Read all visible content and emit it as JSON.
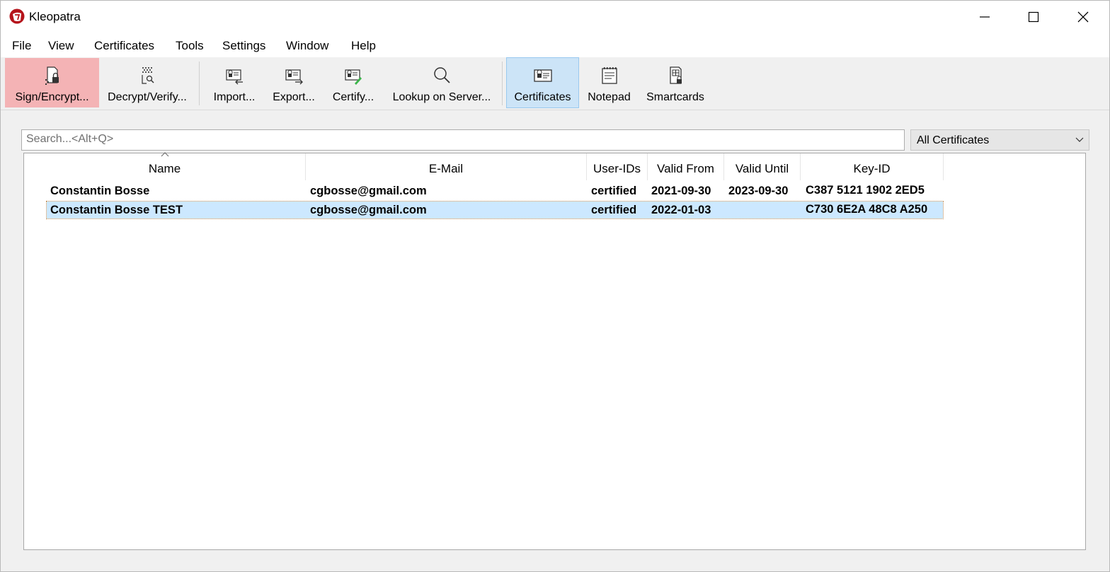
{
  "window": {
    "title": "Kleopatra"
  },
  "menu": [
    "File",
    "View",
    "Certificates",
    "Tools",
    "Settings",
    "Window",
    "Help"
  ],
  "toolbar": {
    "sign_encrypt": "Sign/Encrypt...",
    "decrypt_verify": "Decrypt/Verify...",
    "import": "Import...",
    "export": "Export...",
    "certify": "Certify...",
    "lookup": "Lookup on Server...",
    "certificates": "Certificates",
    "notepad": "Notepad",
    "smartcards": "Smartcards"
  },
  "search": {
    "placeholder": "Search...<Alt+Q>",
    "value": ""
  },
  "filter": {
    "selected": "All Certificates"
  },
  "table": {
    "headers": [
      "Name",
      "E-Mail",
      "User-IDs",
      "Valid From",
      "Valid Until",
      "Key-ID"
    ],
    "rows": [
      {
        "name": "Constantin Bosse",
        "email": "cgbosse@gmail.com",
        "user_ids": "certified",
        "valid_from": "2021-09-30",
        "valid_until": "2023-09-30",
        "key_id": "C387 5121 1902 2ED5"
      },
      {
        "name": "Constantin Bosse TEST",
        "email": "cgbosse@gmail.com",
        "user_ids": "certified",
        "valid_from": "2022-01-03",
        "valid_until": "",
        "key_id": "C730 6E2A 48C8 A250"
      }
    ]
  },
  "colors": {
    "active_action": "#f4b3b5",
    "active_view": "#cce4f7",
    "selected_row": "#cce8ff"
  }
}
